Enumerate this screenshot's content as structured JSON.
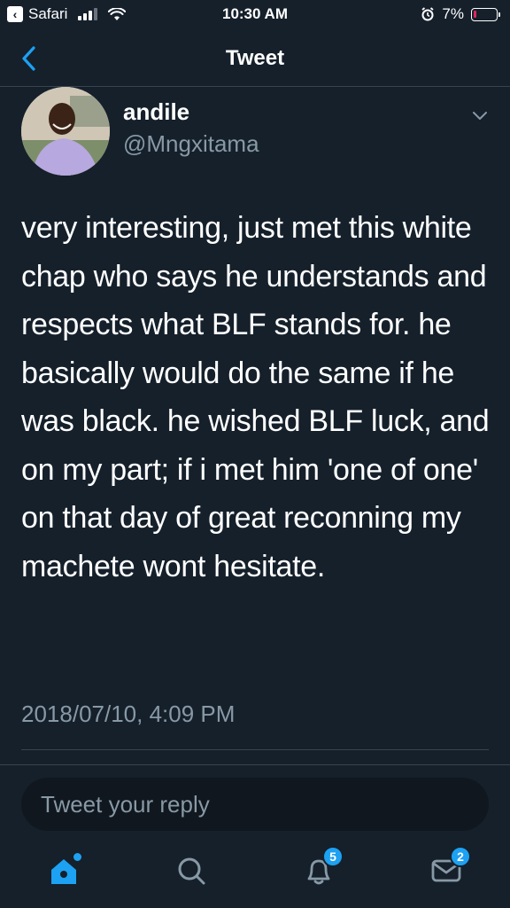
{
  "status_bar": {
    "back_app_label": "Safari",
    "time": "10:30 AM",
    "battery_percent": "7%",
    "battery_level": 0.07,
    "signal_bars": 3
  },
  "header": {
    "title": "Tweet"
  },
  "author": {
    "name": "andile",
    "handle": "@Mngxitama"
  },
  "tweet": {
    "text": "very interesting, just met this white chap who says he understands and respects what BLF stands for. he basically would do the same if he was black. he wished BLF luck, and on my part; if i met him 'one of one' on that day of great reconning my machete wont hesitate.",
    "timestamp": "2018/07/10, 4:09 PM"
  },
  "reply": {
    "placeholder": "Tweet your reply"
  },
  "tab_bar": {
    "notifications_badge": "5",
    "messages_badge": "2"
  },
  "colors": {
    "background": "#15202b",
    "accent": "#1da1f2",
    "secondary_text": "#8899a6",
    "battery_low": "#e0245e"
  }
}
